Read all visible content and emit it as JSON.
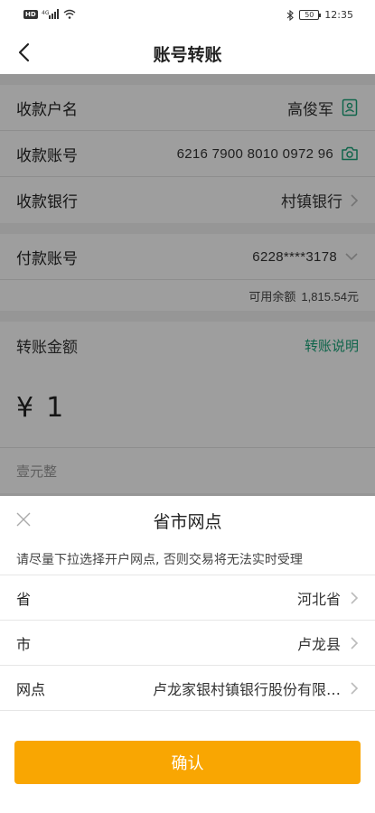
{
  "status_bar": {
    "network": "HD",
    "signal_label": "⁴ᴳ",
    "battery": "50",
    "time": "12:35"
  },
  "nav": {
    "title": "账号转账"
  },
  "payee": {
    "name_label": "收款户名",
    "name_value": "高俊军",
    "account_label": "收款账号",
    "account_value": "6216 7900 8010 0972 96",
    "bank_label": "收款银行",
    "bank_value": "村镇银行"
  },
  "payer": {
    "account_label": "付款账号",
    "account_value": "6228****3178",
    "balance_label": "可用余额",
    "balance_value": "1,815.54元"
  },
  "amount": {
    "label": "转账金额",
    "instructions_link": "转账说明",
    "currency_symbol": "¥",
    "value": "1",
    "in_words": "壹元整"
  },
  "sheet": {
    "title": "省市网点",
    "hint": "请尽量下拉选择开户网点, 否则交易将无法实时受理",
    "rows": [
      {
        "label": "省",
        "value": "河北省"
      },
      {
        "label": "市",
        "value": "卢龙县"
      },
      {
        "label": "网点",
        "value": "卢龙家银村镇银行股份有限…"
      }
    ],
    "confirm_label": "确认"
  },
  "colors": {
    "accent_green": "#1aa37a",
    "confirm_orange": "#f9a602",
    "overlay": "rgba(0,0,0,0.38)"
  },
  "icons": {
    "back": "chevron-left-icon",
    "contact": "contact-book-icon",
    "camera": "camera-icon",
    "chevron_right": "chevron-right-icon",
    "chevron_down": "chevron-down-icon",
    "close": "close-icon",
    "bluetooth": "bluetooth-icon",
    "wifi": "wifi-icon"
  }
}
